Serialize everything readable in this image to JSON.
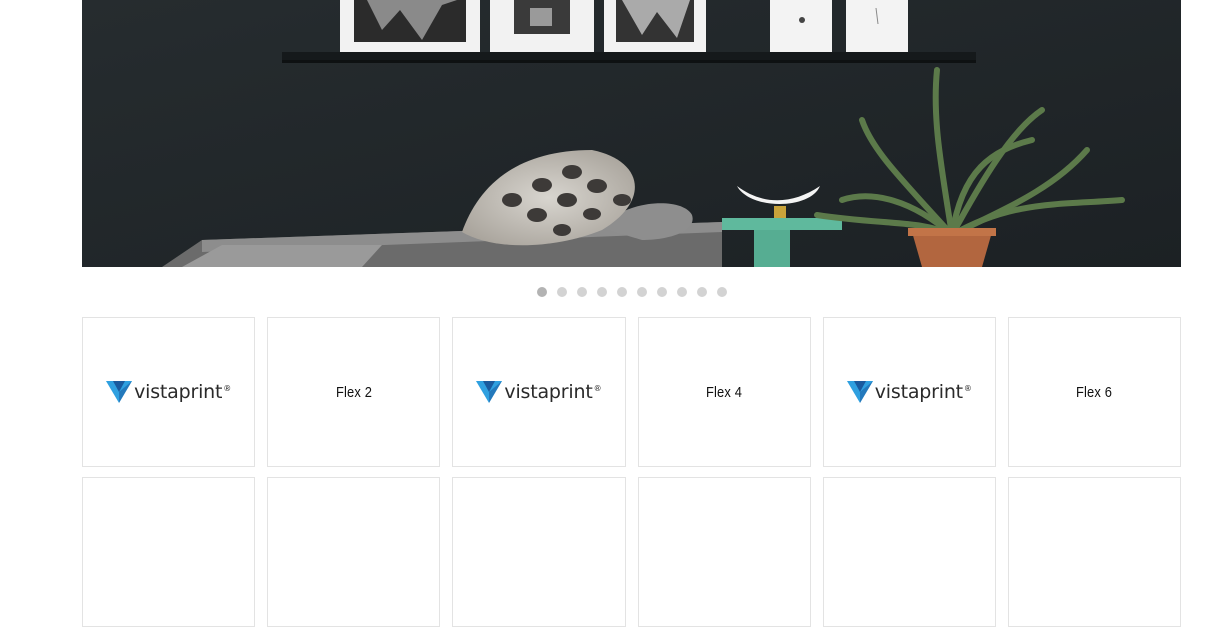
{
  "hero": {
    "image": "photo-dark-wall-with-framed-prints-daybed-pillows-and-potted-agave"
  },
  "carousel": {
    "dot_count": 10,
    "active_index": 0
  },
  "tiles": [
    {
      "type": "logo",
      "brand": "vistaprint",
      "trademark": "®"
    },
    {
      "type": "text",
      "label": "Flex 2"
    },
    {
      "type": "logo",
      "brand": "vistaprint",
      "trademark": "®"
    },
    {
      "type": "text",
      "label": "Flex 4"
    },
    {
      "type": "logo",
      "brand": "vistaprint",
      "trademark": "®"
    },
    {
      "type": "text",
      "label": "Flex 6"
    }
  ],
  "colors": {
    "logo_blue_dark": "#1a5a9e",
    "logo_blue_light": "#2fa0e0",
    "tile_border": "#e3e3e3",
    "dot_inactive": "#d3d3d3",
    "dot_active": "#b3b3b3"
  }
}
